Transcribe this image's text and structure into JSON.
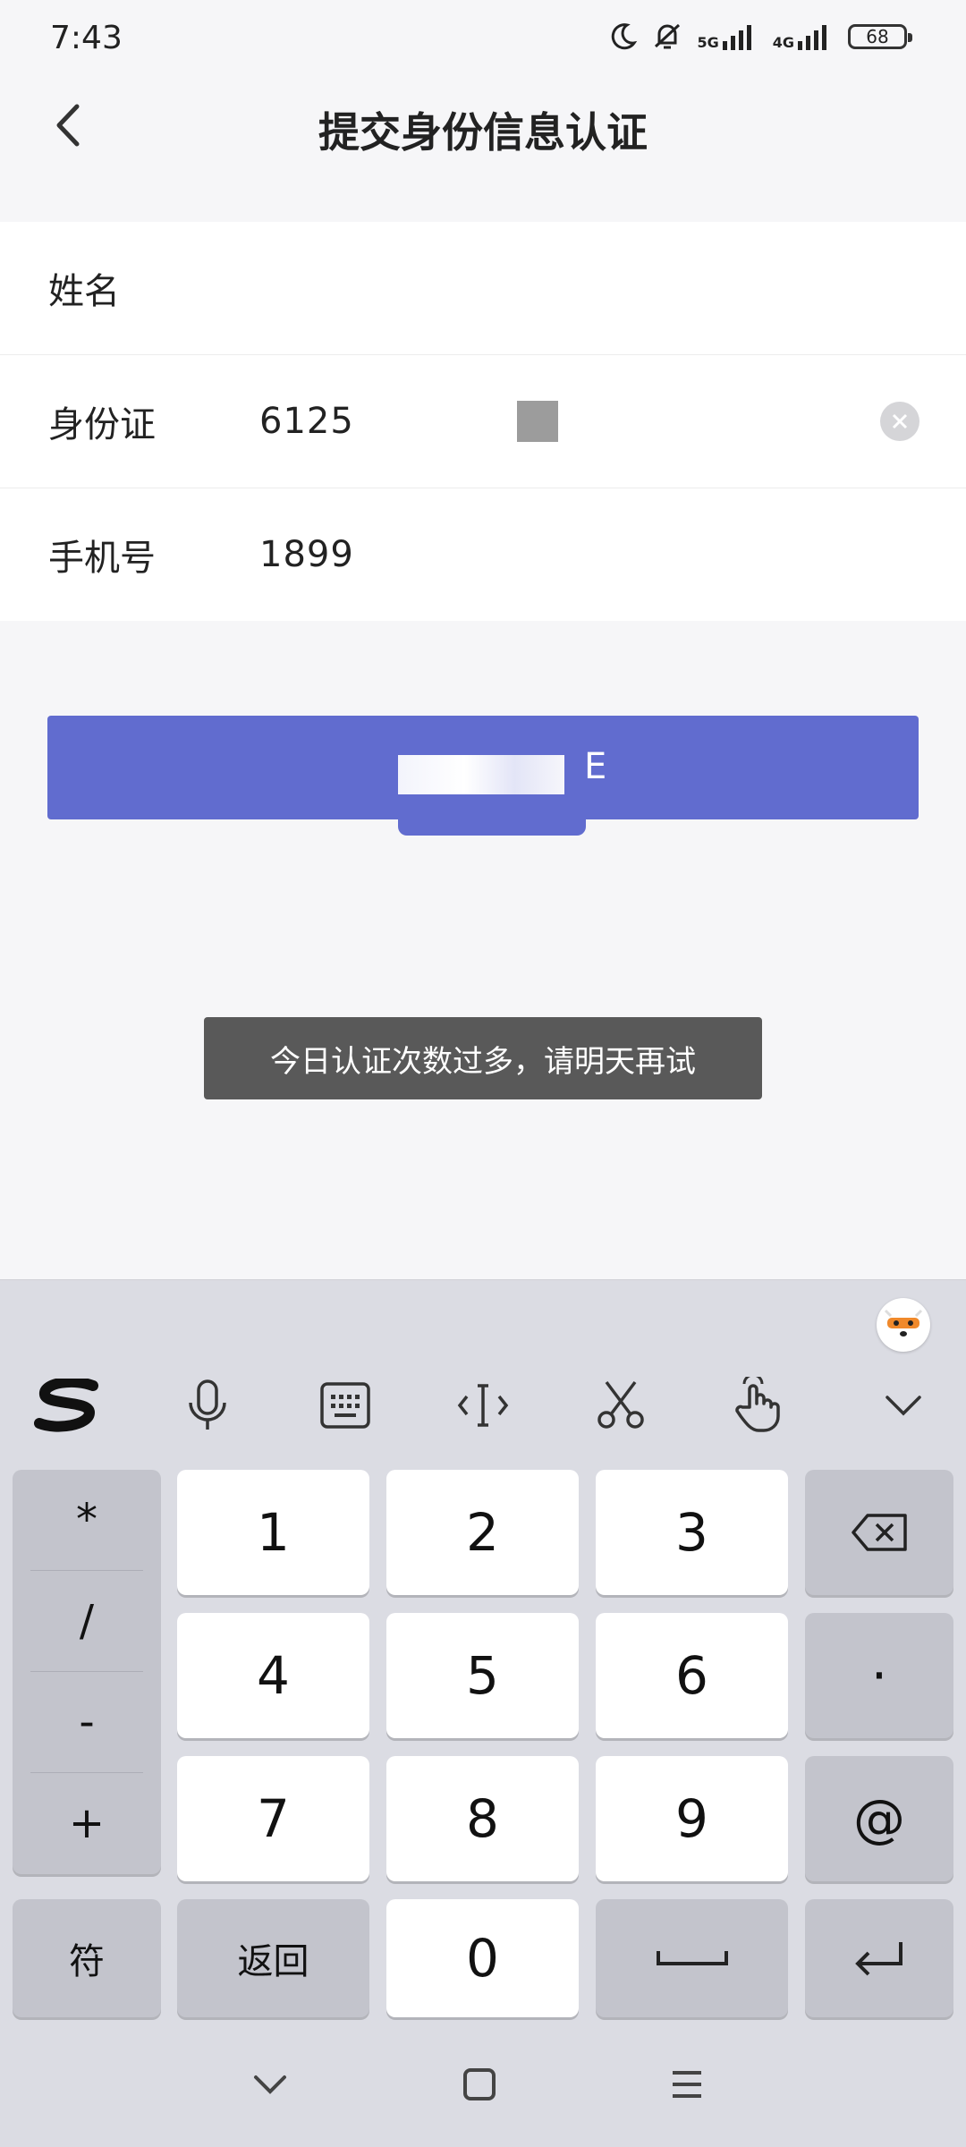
{
  "status_bar": {
    "time": "7:43",
    "net1": "5G",
    "net2": "4G",
    "battery": "68"
  },
  "header": {
    "title": "提交身份信息认证"
  },
  "form": {
    "name_label": "姓名",
    "name_value": "",
    "id_label": "身份证",
    "id_value": "6125",
    "phone_label": "手机号",
    "phone_value": "1899"
  },
  "submit": {
    "label_visible": "E"
  },
  "toast": {
    "message": "今日认证次数过多，请明天再试"
  },
  "keyboard": {
    "symbols": [
      "*",
      "/",
      "-",
      "+"
    ],
    "digits": [
      "1",
      "2",
      "3",
      "4",
      "5",
      "6",
      "7",
      "8",
      "9",
      "0"
    ],
    "dot": "·",
    "at": "@",
    "sym_key": "符",
    "back_key": "返回"
  },
  "icons": {
    "back": "chevron-left-icon",
    "clear": "clear-circle-icon",
    "sogou": "sogou-logo-icon",
    "mic": "microphone-icon",
    "kb": "keyboard-icon",
    "cursor": "cursor-move-icon",
    "cut": "scissors-icon",
    "gesture": "hand-gesture-icon",
    "collapse": "chevron-down-icon"
  },
  "colors": {
    "accent": "#616ccf",
    "toast_bg": "#595959"
  }
}
